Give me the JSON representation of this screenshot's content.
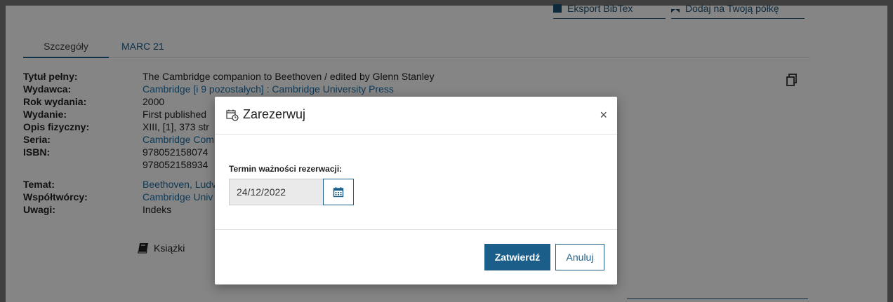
{
  "top_actions": {
    "export": "Eksport BibTex",
    "shelf": "Dodaj na Twoją półkę"
  },
  "tabs": [
    {
      "label": "Szczegóły"
    },
    {
      "label": "MARC 21"
    }
  ],
  "details": {
    "title_label": "Tytuł pełny:",
    "title_value": "The Cambridge companion to Beethoven / edited by Glenn Stanley",
    "publisher_label": "Wydawca:",
    "publisher_value": "Cambridge [i 9 pozostałych] : Cambridge University Press",
    "year_label": "Rok wydania:",
    "year_value": "2000",
    "edition_label": "Wydanie:",
    "edition_value": "First published",
    "physical_label": "Opis fizyczny:",
    "physical_value": "XIII, [1], 373 str",
    "series_label": "Seria:",
    "series_value": "Cambridge Com",
    "isbn_label": "ISBN:",
    "isbn_value_1": "978052158074",
    "isbn_value_2": "978052158934",
    "subject_label": "Temat:",
    "subject_value": "Beethoven, Ludv",
    "contributors_label": "Współtwórcy:",
    "contributors_value": "Cambridge Univ",
    "notes_label": "Uwagi:",
    "notes_value": "Indeks"
  },
  "format": {
    "label": "Książki",
    "icon": "book-icon"
  },
  "modal": {
    "title": "Zarezerwuj",
    "title_icon": "calendar-clock-icon",
    "close": "×",
    "field_label": "Termin ważności rezerwacji:",
    "date_value": "24/12/2022",
    "calendar_icon": "calendar-icon",
    "confirm_label": "Zatwierdź",
    "cancel_label": "Anuluj"
  },
  "colors": {
    "accent": "#1b5e8a",
    "link": "#1b6fa8",
    "overlay": "rgba(0,0,0,0.48)"
  }
}
